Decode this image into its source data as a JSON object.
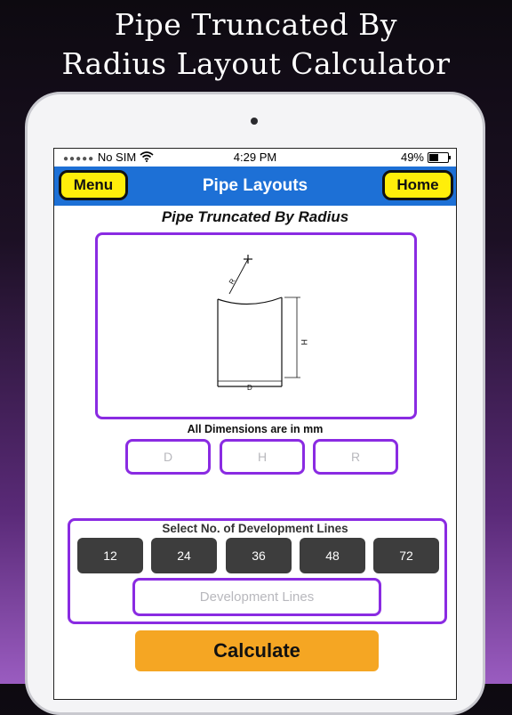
{
  "headline": {
    "line1": "Pipe Truncated By",
    "line2": "Radius Layout Calculator"
  },
  "status": {
    "carrier": "No SIM",
    "time": "4:29 PM",
    "battery": "49%"
  },
  "nav": {
    "menu_label": "Menu",
    "title": "Pipe Layouts",
    "home_label": "Home"
  },
  "page": {
    "title": "Pipe Truncated By Radius",
    "dims_note": "All Dimensions are in mm"
  },
  "diagram": {
    "label_r": "R",
    "label_h": "H",
    "label_d": "D"
  },
  "inputs": {
    "d_placeholder": "D",
    "h_placeholder": "H",
    "r_placeholder": "R"
  },
  "development": {
    "label": "Select No. of Development Lines",
    "options": [
      "12",
      "24",
      "36",
      "48",
      "72"
    ],
    "input_placeholder": "Development Lines"
  },
  "calculate_label": "Calculate",
  "colors": {
    "nav_blue": "#1d70d6",
    "button_yellow": "#ffee0a",
    "border_purple": "#8a2be2",
    "calc_orange": "#f5a623",
    "line_button_gray": "#3d3d3d"
  }
}
